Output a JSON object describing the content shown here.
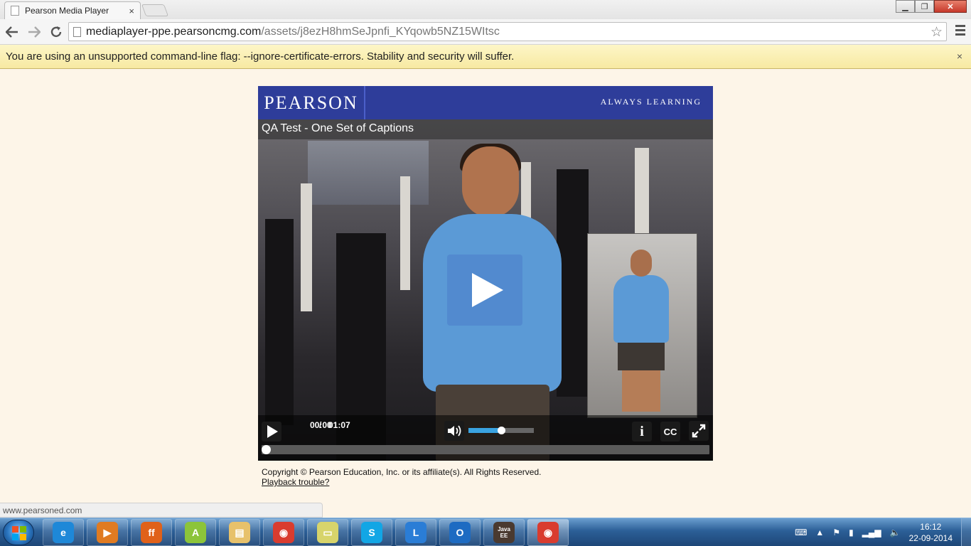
{
  "browser": {
    "tab_title": "Pearson Media Player",
    "tab_close": "×",
    "url_host": "mediaplayer-ppe.pearsoncmg.com",
    "url_path": "/assets/j8ezH8hmSeJpnfi_KYqowb5NZ15WItsc",
    "back_icon": "back-arrow-icon",
    "forward_icon": "forward-arrow-icon",
    "reload_icon": "reload-icon",
    "star": "☆",
    "window": {
      "minimize": "▁",
      "maximize": "❐",
      "close": "✕"
    }
  },
  "infobar": {
    "message": "You are using an unsupported command-line flag: --ignore-certificate-errors. Stability and security will suffer.",
    "close": "×"
  },
  "player": {
    "brand_logo": "PEARSON",
    "brand_tagline": "ALWAYS LEARNING",
    "video_title": "QA Test - One Set of Captions",
    "current_time": "00:00",
    "time_separator": "/",
    "duration": "01:07",
    "volume_level": 0.5,
    "seek_progress": 0.0,
    "info_label": "i",
    "cc_label": "CC",
    "colors": {
      "brand": "#2e3d9a",
      "accent": "#3aa3e0"
    }
  },
  "footer": {
    "copyright": "Copyright © Pearson Education, Inc. or its affiliate(s). All Rights Reserved.",
    "playback_link": "Playback trouble?"
  },
  "status_url": "www.pearsoned.com",
  "taskbar": {
    "items": [
      {
        "name": "internet-explorer-icon",
        "glyph": "e",
        "color": "#1e88d8"
      },
      {
        "name": "media-player-icon",
        "glyph": "▶",
        "color": "#e07b22"
      },
      {
        "name": "firefox-icon",
        "glyph": "ff",
        "color": "#e0611a"
      },
      {
        "name": "android-icon",
        "glyph": "A",
        "color": "#8cc43a"
      },
      {
        "name": "file-explorer-icon",
        "glyph": "▤",
        "color": "#e7c16b"
      },
      {
        "name": "chrome-icon",
        "glyph": "◉",
        "color": "#d93c2f"
      },
      {
        "name": "sticky-notes-icon",
        "glyph": "▭",
        "color": "#d7d46b"
      },
      {
        "name": "skype-icon",
        "glyph": "S",
        "color": "#12a6e5"
      },
      {
        "name": "lync-icon",
        "glyph": "L",
        "color": "#2a7dd6"
      },
      {
        "name": "outlook-icon",
        "glyph": "O",
        "color": "#1d6bc2"
      },
      {
        "name": "eclipse-java-ee-icon",
        "glyph": "Java EE",
        "color": "#4a3a30"
      },
      {
        "name": "chrome-active-icon",
        "glyph": "◉",
        "color": "#d93c2f"
      }
    ],
    "clock_time": "16:12",
    "clock_date": "22-09-2014"
  }
}
